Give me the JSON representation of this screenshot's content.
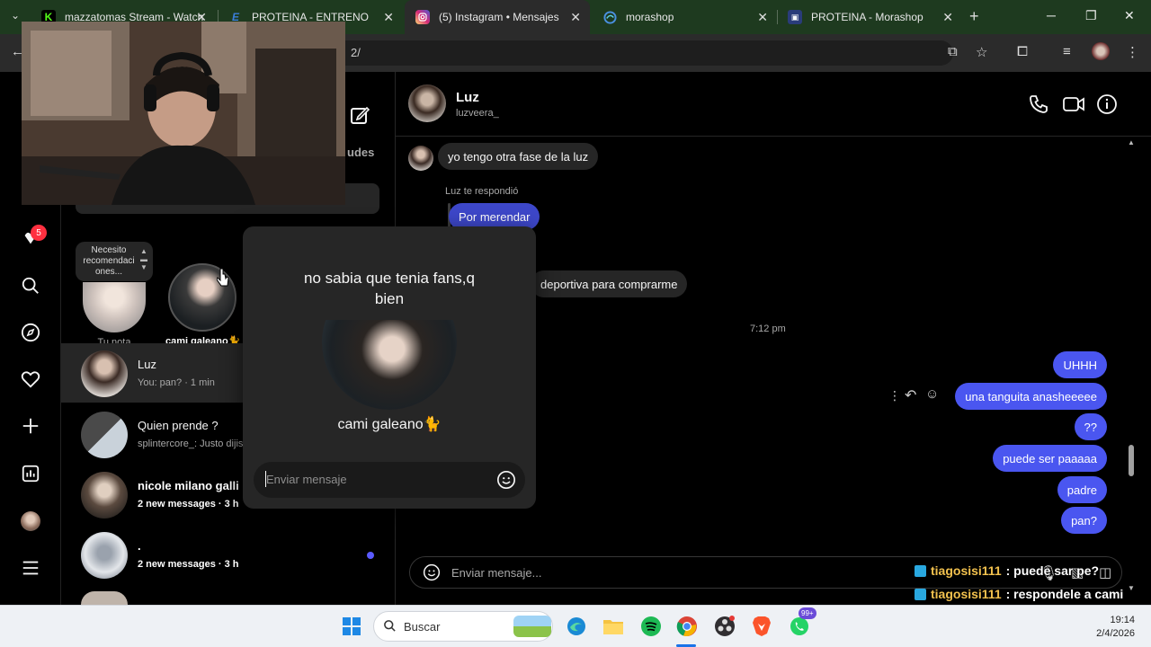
{
  "browser": {
    "tabs": [
      {
        "title": "mazzatomas Stream - Watch",
        "icon_color": "#53fc18",
        "icon": "kick-icon",
        "active": false
      },
      {
        "title": "PROTEINA - ENTRENO",
        "icon_color": "#3b7dd8",
        "icon": "e-icon",
        "active": false
      },
      {
        "title": "(5) Instagram • Mensajes",
        "icon_color": "#d6249f",
        "icon": "instagram-icon",
        "active": true
      },
      {
        "title": "morashop",
        "icon_color": "#4a90e2",
        "icon": "edge-icon",
        "active": false
      },
      {
        "title": "PROTEINA - Morashop",
        "icon_color": "#6a7fd0",
        "icon": "shop-icon",
        "active": false
      }
    ],
    "address_visible": "2/"
  },
  "instagram": {
    "rail_badge": "5",
    "solicitudes_fragment": "udes",
    "note_bubble": "Necesito recomendaci ones...",
    "stories": [
      {
        "label": "Tu nota"
      },
      {
        "label": "cami galeano🐈"
      }
    ],
    "conversations": [
      {
        "name": "Luz",
        "preview": "You: pan? · 1 min",
        "unread": false,
        "selected": true
      },
      {
        "name": "Quien prende ?",
        "preview": "splintercore_: Justo dijis",
        "unread": false,
        "selected": false
      },
      {
        "name": "nicole milano galli",
        "preview": "2 new messages · 3 h",
        "unread": true,
        "selected": false
      },
      {
        "name": ".",
        "preview": "2 new messages · 3 h",
        "unread": true,
        "selected": false
      }
    ],
    "chat": {
      "name": "Luz",
      "handle": "luzveera_",
      "messages": {
        "in_1": "yo tengo otra fase de la luz",
        "reply_label": "Luz te respondió",
        "reply_quote": "Por merendar",
        "in_2": "deportiva para comprarme",
        "time": "7:12 pm",
        "out": [
          "UHHH",
          "una tanguita anasheeeee",
          "??",
          "puede ser paaaaa",
          "padre",
          "pan?"
        ]
      },
      "input_placeholder": "Enviar mensaje..."
    },
    "popup": {
      "note": "no sabia que tenia fans,q bien",
      "name": "cami galeano🐈",
      "input_placeholder": "Enviar mensaje"
    }
  },
  "stream_chat": [
    {
      "user": "tiagosisi111",
      "text": ": puede sar pe?"
    },
    {
      "user": "tiagosisi111",
      "text": ": respondele a cami"
    }
  ],
  "taskbar": {
    "search_label": "Buscar",
    "time": "19:14",
    "date": "2/4/2026",
    "whatsapp_badge": "99+"
  }
}
